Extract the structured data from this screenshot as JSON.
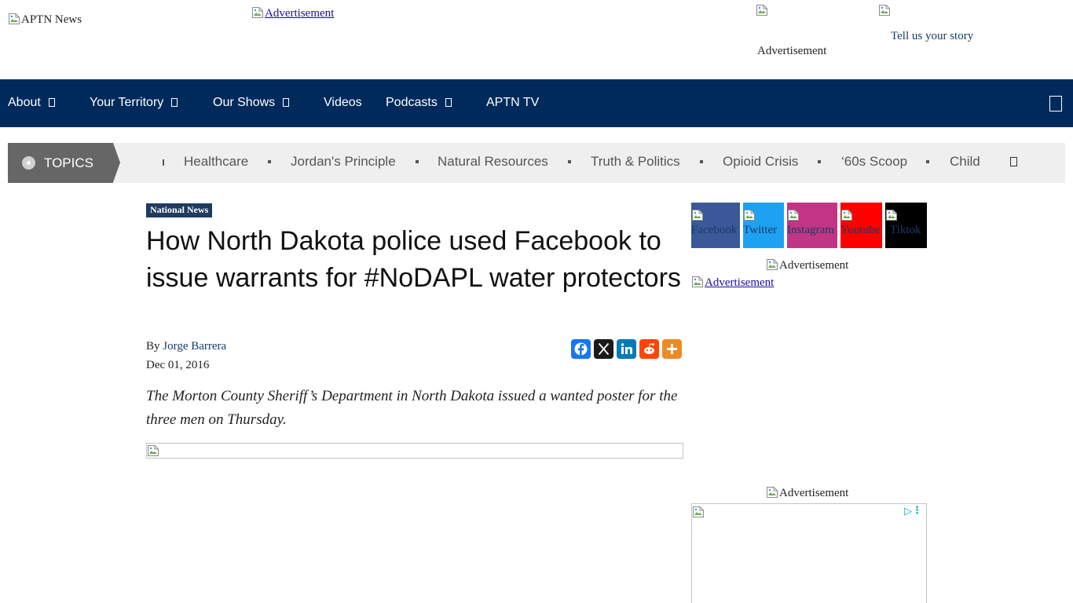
{
  "header": {
    "logo_alt": "APTN News",
    "top_ad": "Advertisement",
    "right_ad": "Advertisement",
    "story_link": "Tell us your story"
  },
  "nav": {
    "items": [
      {
        "label": "About"
      },
      {
        "label": "Your Territory"
      },
      {
        "label": "Our Shows"
      },
      {
        "label": "Videos"
      },
      {
        "label": "Podcasts"
      },
      {
        "label": "APTN TV"
      }
    ]
  },
  "topics": {
    "label": "TOPICS",
    "items": [
      "Healthcare",
      "Jordan's Principle",
      "Natural Resources",
      "Truth & Politics",
      "Opioid Crisis",
      "‘60s Scoop",
      "Child W"
    ]
  },
  "article": {
    "category": "National News",
    "title": "How North Dakota police used Facebook to issue warrants for #NoDAPL water protectors",
    "by": "By",
    "author": "Jorge Barrera",
    "date": "Dec 01, 2016",
    "lede": "The Morton County Sheriff’s Department in North Dakota issued a wanted poster for the three men on Thursday."
  },
  "share": {
    "buttons": [
      "facebook",
      "x",
      "linkedin",
      "reddit",
      "more"
    ],
    "colors": {
      "facebook": "#1877f2",
      "x": "#1a1a1a",
      "linkedin": "#007bb5",
      "reddit": "#ff4500",
      "more": "#f08a24"
    }
  },
  "sidebar": {
    "social": [
      {
        "label": "Facebook",
        "color": "#3b5998"
      },
      {
        "label": "Twitter",
        "color": "#1da1f2"
      },
      {
        "label": "Instagram",
        "color": "#c13584"
      },
      {
        "label": "Youtube",
        "color": "#ff0000"
      },
      {
        "label": "Tiktok",
        "color": "#000000"
      }
    ],
    "ad_label_1": "Advertisement",
    "ad_link": "Advertisement",
    "ad_label_2": "Advertisement"
  },
  "colors": {
    "nav_bg": "#002a5c",
    "topics_bg": "#efefef",
    "badge_bg": "#1f3b5f"
  }
}
